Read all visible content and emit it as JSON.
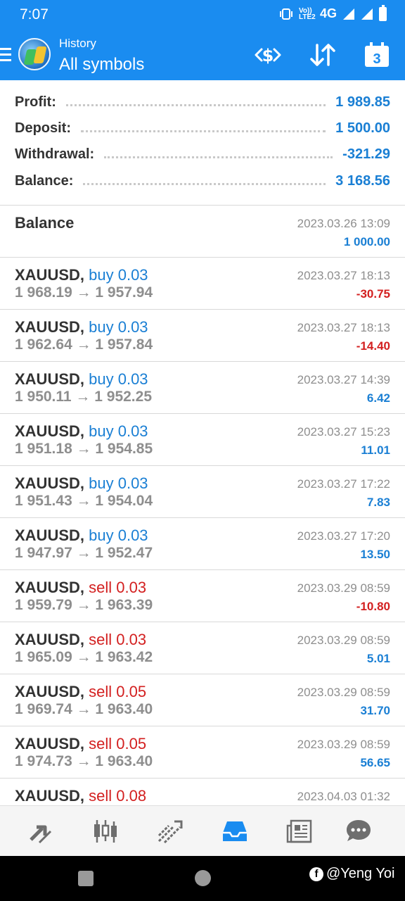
{
  "status_bar": {
    "time": "7:07",
    "network": "4G",
    "lte_label": "Vo)) LTE2"
  },
  "app_bar": {
    "subtitle": "History",
    "title": "All symbols",
    "calendar_day": "3",
    "icons": [
      "menu-icon",
      "app-logo",
      "currency-swap-icon",
      "sort-icon",
      "calendar-icon"
    ]
  },
  "summary": {
    "profit": {
      "label": "Profit:",
      "value": "1 989.85"
    },
    "deposit": {
      "label": "Deposit:",
      "value": "1 500.00"
    },
    "withdrawal": {
      "label": "Withdrawal:",
      "value": "-321.29"
    },
    "balance": {
      "label": "Balance:",
      "value": "3 168.56"
    }
  },
  "deals": [
    {
      "title": "Balance",
      "date": "2023.03.26 13:09",
      "profit": "1 000.00",
      "sign": "pos"
    },
    {
      "symbol": "XAUUSD,",
      "side": "buy 0.03",
      "type": "buy",
      "prices": "1 968.19 → 1 957.94",
      "date": "2023.03.27 18:13",
      "profit": "-30.75",
      "sign": "neg"
    },
    {
      "symbol": "XAUUSD,",
      "side": "buy 0.03",
      "type": "buy",
      "prices": "1 962.64 → 1 957.84",
      "date": "2023.03.27 18:13",
      "profit": "-14.40",
      "sign": "neg"
    },
    {
      "symbol": "XAUUSD,",
      "side": "buy 0.03",
      "type": "buy",
      "prices": "1 950.11 → 1 952.25",
      "date": "2023.03.27 14:39",
      "profit": "6.42",
      "sign": "pos"
    },
    {
      "symbol": "XAUUSD,",
      "side": "buy 0.03",
      "type": "buy",
      "prices": "1 951.18 → 1 954.85",
      "date": "2023.03.27 15:23",
      "profit": "11.01",
      "sign": "pos"
    },
    {
      "symbol": "XAUUSD,",
      "side": "buy 0.03",
      "type": "buy",
      "prices": "1 951.43 → 1 954.04",
      "date": "2023.03.27 17:22",
      "profit": "7.83",
      "sign": "pos"
    },
    {
      "symbol": "XAUUSD,",
      "side": "buy 0.03",
      "type": "buy",
      "prices": "1 947.97 → 1 952.47",
      "date": "2023.03.27 17:20",
      "profit": "13.50",
      "sign": "pos"
    },
    {
      "symbol": "XAUUSD,",
      "side": "sell 0.03",
      "type": "sell",
      "prices": "1 959.79 → 1 963.39",
      "date": "2023.03.29 08:59",
      "profit": "-10.80",
      "sign": "neg"
    },
    {
      "symbol": "XAUUSD,",
      "side": "sell 0.03",
      "type": "sell",
      "prices": "1 965.09 → 1 963.42",
      "date": "2023.03.29 08:59",
      "profit": "5.01",
      "sign": "pos"
    },
    {
      "symbol": "XAUUSD,",
      "side": "sell 0.05",
      "type": "sell",
      "prices": "1 969.74 → 1 963.40",
      "date": "2023.03.29 08:59",
      "profit": "31.70",
      "sign": "pos"
    },
    {
      "symbol": "XAUUSD,",
      "side": "sell 0.05",
      "type": "sell",
      "prices": "1 974.73 → 1 963.40",
      "date": "2023.03.29 08:59",
      "profit": "56.65",
      "sign": "pos"
    },
    {
      "symbol": "XAUUSD,",
      "side": "sell 0.08",
      "type": "sell",
      "prices": "",
      "date": "2023.04.03 01:32",
      "profit": "",
      "sign": "pos"
    }
  ],
  "bottom_nav": {
    "items": [
      "quotes-icon",
      "chart-icon",
      "trade-icon",
      "history-icon",
      "news-icon",
      "chat-icon"
    ],
    "active": "history-icon"
  },
  "watermark": "@Yeng Yoi",
  "colors": {
    "accent": "#1a8cf0",
    "positive": "#1a7fd4",
    "negative": "#d32020",
    "muted": "#8e8e8e"
  }
}
